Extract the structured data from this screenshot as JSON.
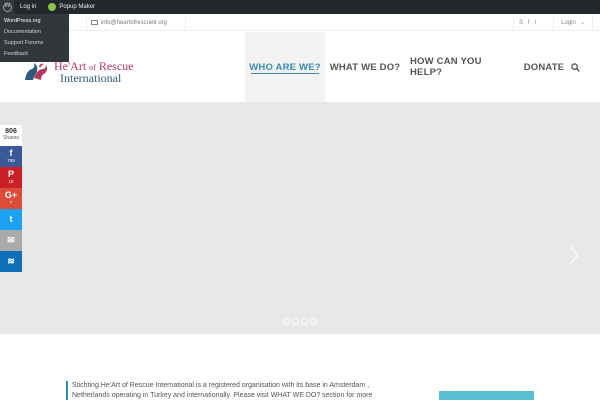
{
  "admin_bar": {
    "login_label": "Log in",
    "popup_maker_label": "Popup Maker",
    "wp_menu": [
      "WordPress.org",
      "Documentation",
      "Support Forums",
      "Feedback"
    ]
  },
  "topbar": {
    "email": "info@heartofrescuetr.org",
    "social_icons": [
      "skype-icon",
      "facebook-icon",
      "twitter-icon"
    ],
    "login_label": "Login"
  },
  "header": {
    "logo_line1": "He'Art",
    "logo_of": "of",
    "logo_line1_end": "Rescue",
    "logo_line2": "International",
    "nav": [
      "WHO ARE WE?",
      "WHAT WE DO?",
      "HOW CAN YOU HELP?",
      "DONATE"
    ],
    "active_nav": "WHO ARE WE?"
  },
  "share": {
    "total": "806",
    "total_label": "Shares",
    "buttons": [
      {
        "network": "facebook",
        "glyph": "f",
        "count": "769",
        "color": "#3b5998"
      },
      {
        "network": "pinterest",
        "glyph": "P",
        "count": "15",
        "color": "#cb2027"
      },
      {
        "network": "google-plus",
        "glyph": "G+",
        "count": "7",
        "color": "#dd4b39"
      },
      {
        "network": "twitter",
        "glyph": "t",
        "count": "",
        "color": "#1da1f2"
      },
      {
        "network": "email",
        "glyph": "✉",
        "count": "",
        "color": "#aaaaaa"
      },
      {
        "network": "sumome",
        "glyph": "≋",
        "count": "",
        "color": "#0f6fb8"
      }
    ]
  },
  "intro": {
    "line1": "Stichting He'Art of Rescue International is a registered organisation with its base in Amsterdam ,",
    "line2": "Netherlands operating in Turkey and internationally. Please visit WHAT WE DO? section for more"
  },
  "colors": {
    "accent": "#3a8bb5",
    "brand_pink": "#b03a5b",
    "brand_blue": "#2f5b7c",
    "cta": "#58bfd0"
  }
}
